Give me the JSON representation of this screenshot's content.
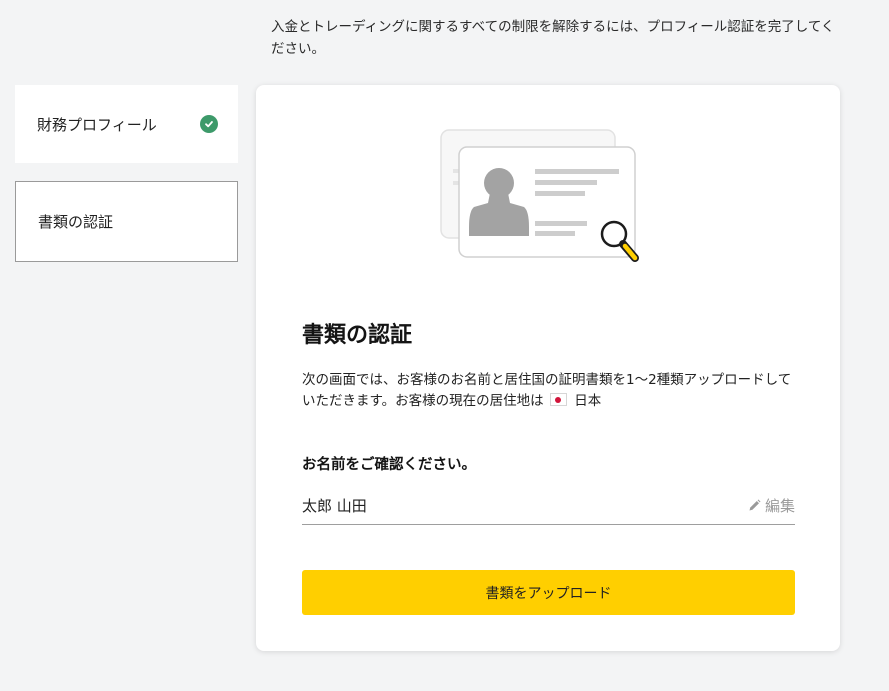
{
  "intro_text": "入金とトレーディングに関するすべての制限を解除するには、プロフィール認証を完了してください。",
  "sidebar": {
    "items": [
      {
        "label": "財務プロフィール",
        "status": "completed",
        "icon": "check-icon"
      },
      {
        "label": "書類の認証",
        "status": "active"
      }
    ]
  },
  "card": {
    "illustration": "id-card-with-magnifier",
    "title": "書類の認証",
    "description_prefix": "次の画面では、お客様のお名前と居住国の証明書類を1〜2種類アップロードしていただきます。お客様の現在の居住地は",
    "country_flag": "japan-flag-icon",
    "country_name": "日本",
    "name_label": "お名前をご確認ください。",
    "name_value": "太郎 山田",
    "edit_label": "編集",
    "edit_icon": "pencil-icon",
    "upload_button": "書類をアップロード"
  },
  "colors": {
    "accent": "#ffcf00",
    "success": "#3d9a6a",
    "background": "#f3f4f5"
  }
}
